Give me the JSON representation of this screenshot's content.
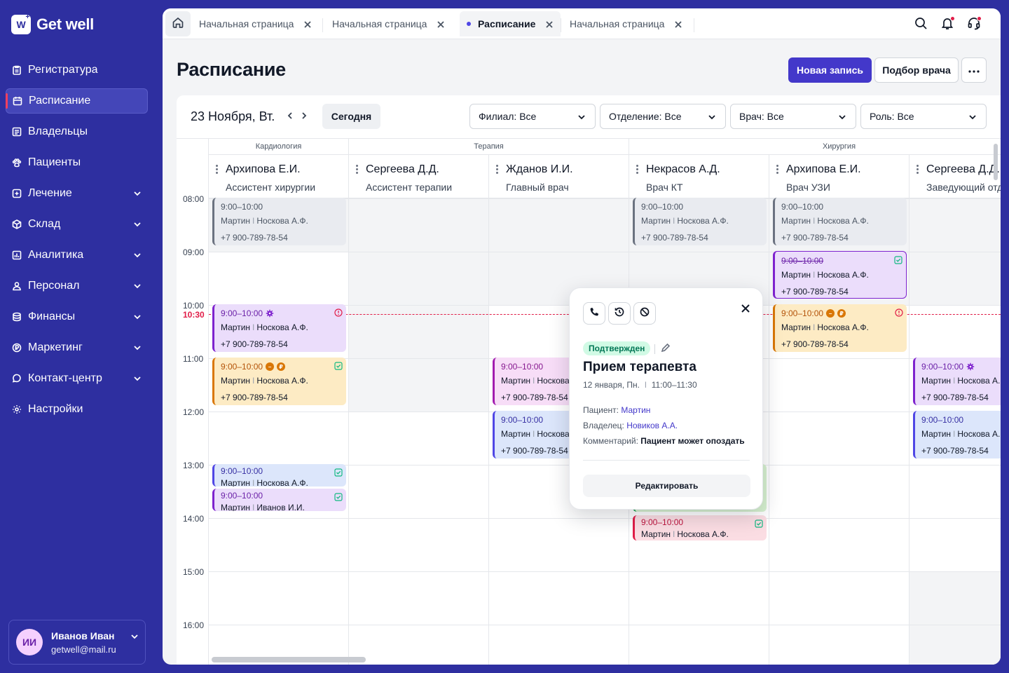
{
  "brand": {
    "name": "Get well"
  },
  "sidebar": {
    "items": [
      {
        "label": "Регистратура",
        "icon": "clipboard-icon",
        "expandable": false,
        "active": false
      },
      {
        "label": "Расписание",
        "icon": "calendar-icon",
        "expandable": false,
        "active": true
      },
      {
        "label": "Владельцы",
        "icon": "contacts-icon",
        "expandable": false,
        "active": false
      },
      {
        "label": "Пациенты",
        "icon": "paw-icon",
        "expandable": false,
        "active": false
      },
      {
        "label": "Лечение",
        "icon": "plus-square-icon",
        "expandable": true,
        "active": false
      },
      {
        "label": "Склад",
        "icon": "box-icon",
        "expandable": true,
        "active": false
      },
      {
        "label": "Аналитика",
        "icon": "chart-icon",
        "expandable": true,
        "active": false
      },
      {
        "label": "Персонал",
        "icon": "person-icon",
        "expandable": true,
        "active": false
      },
      {
        "label": "Финансы",
        "icon": "coins-icon",
        "expandable": true,
        "active": false
      },
      {
        "label": "Маркетинг",
        "icon": "ruble-icon",
        "expandable": true,
        "active": false
      },
      {
        "label": "Контакт-центр",
        "icon": "chat-icon",
        "expandable": true,
        "active": false
      },
      {
        "label": "Настройки",
        "icon": "gear-icon",
        "expandable": false,
        "active": false
      }
    ],
    "user": {
      "initials": "ИИ",
      "name": "Иванов Иван",
      "email": "getwell@mail.ru"
    }
  },
  "tabs": [
    {
      "label": "Начальная страница",
      "active": false
    },
    {
      "label": "Начальная страница",
      "active": false
    },
    {
      "label": "Расписание",
      "active": true
    },
    {
      "label": "Начальная страница",
      "active": false
    }
  ],
  "page": {
    "title": "Расписание",
    "new_record": "Новая запись",
    "pick_doctor": "Подбор врача"
  },
  "toolbar": {
    "date": "23 Ноября, Вт.",
    "today": "Сегодня",
    "filters": [
      "Филиал: Все",
      "Отделение: Все",
      "Врач: Все",
      "Роль: Все"
    ]
  },
  "departments": [
    "Кардиология",
    "Терапия",
    "Хирургия"
  ],
  "doctors": [
    {
      "name": "Архипова Е.И.",
      "role": "Ассистент хирургии"
    },
    {
      "name": "Сергеева Д.Д.",
      "role": "Ассистент терапии"
    },
    {
      "name": "Жданов И.И.",
      "role": "Главный врач"
    },
    {
      "name": "Некрасов А.Д.",
      "role": "Врач КТ"
    },
    {
      "name": "Архипова Е.И.",
      "role": "Врач УЗИ"
    },
    {
      "name": "Сергеева Д.Д.",
      "role": "Заведующий отд."
    }
  ],
  "times": [
    "08:00",
    "09:00",
    "10:00",
    "11:00",
    "12:00",
    "13:00",
    "14:00",
    "15:00",
    "16:00"
  ],
  "now_time": "10:30",
  "appt": {
    "time": "9:00–10:00",
    "pet": "Мартин",
    "owner": "Носкова А.Ф.",
    "owner_alt": "Иванов И.И.",
    "phone": "+7 900-789-78-54"
  },
  "popover": {
    "status": "Подтвержден",
    "title": "Прием терапевта",
    "date": "12 января, Пн.",
    "time": "11:00–11:30",
    "patient_label": "Пациент:",
    "patient": "Мартин",
    "owner_label": "Владелец:",
    "owner": "Новиков А.А.",
    "comment_label": "Комментарий:",
    "comment": "Пациент может опоздать",
    "edit": "Редактировать"
  },
  "colors": {
    "sidebar_bg": "#2E2FA0",
    "accent": "#4338CA",
    "now_line": "#E11D48",
    "status_confirmed": "#047857"
  }
}
